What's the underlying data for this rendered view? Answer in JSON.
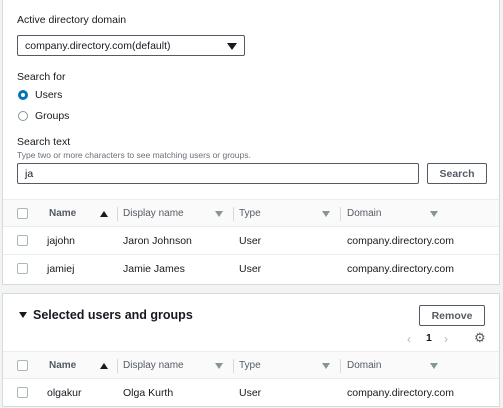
{
  "search_panel": {
    "domain_label": "Active directory domain",
    "domain_value": "company.directory.com(default)",
    "search_for_label": "Search for",
    "option_users": "Users",
    "option_groups": "Groups",
    "selected_option": "Users",
    "search_text_label": "Search text",
    "search_text_hint": "Type two or more characters to see matching users or groups.",
    "search_text_value": "ja",
    "search_button": "Search"
  },
  "results_table": {
    "columns": [
      "Name",
      "Display name",
      "Type",
      "Domain"
    ],
    "rows": [
      {
        "name": "jajohn",
        "display_name": "Jaron Johnson",
        "type": "User",
        "domain": "company.directory.com"
      },
      {
        "name": "jamiej",
        "display_name": "Jamie James",
        "type": "User",
        "domain": "company.directory.com"
      }
    ]
  },
  "selected_panel": {
    "title": "Selected users and groups",
    "remove_button": "Remove",
    "page": "1",
    "prev_glyph": "‹",
    "next_glyph": "›",
    "gear_glyph": "⚙",
    "columns": [
      "Name",
      "Display name",
      "Type",
      "Domain"
    ],
    "rows": [
      {
        "name": "olgakur",
        "display_name": "Olga Kurth",
        "type": "User",
        "domain": "company.directory.com"
      }
    ]
  },
  "icons": [
    "caret-down-icon",
    "radio-selected-icon",
    "sort-ascending-icon",
    "sort-icon",
    "expand-triangle-icon",
    "chevron-left-icon",
    "chevron-right-icon",
    "gear-icon"
  ],
  "colors": {
    "accent": "#0073bb",
    "border": "#d5dbdb",
    "text": "#16191f",
    "muted": "#687078"
  }
}
